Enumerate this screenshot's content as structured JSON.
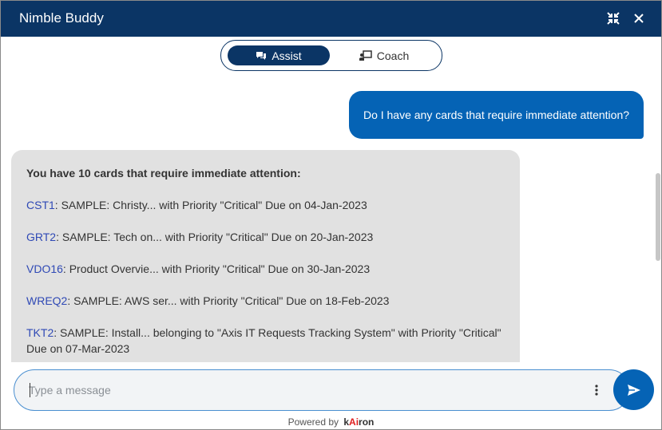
{
  "window": {
    "title": "Nimble Buddy",
    "minimize_icon": "collapse-arrows-icon",
    "close_icon": "close-icon"
  },
  "modes": {
    "assist_label": "Assist",
    "coach_label": "Coach",
    "active": "Assist"
  },
  "conversation": {
    "user_message": "Do I have any cards that require immediate attention?",
    "bot_heading": "You have 10 cards that require immediate attention:",
    "cards": [
      {
        "id": "CST1",
        "text": ": SAMPLE: Christy... with Priority \"Critical\" Due on 04-Jan-2023"
      },
      {
        "id": "GRT2",
        "text": ": SAMPLE: Tech on... with Priority \"Critical\" Due on 20-Jan-2023"
      },
      {
        "id": "VDO16",
        "text": ": Product Overvie... with Priority \"Critical\" Due on 30-Jan-2023"
      },
      {
        "id": "WREQ2",
        "text": ": SAMPLE: AWS ser... with Priority \"Critical\" Due on 18-Feb-2023"
      },
      {
        "id": "TKT2",
        "text": ": SAMPLE: Install... belonging to \"Axis IT Requests Tracking System\" with Priority \"Critical\"",
        "text_line2": "Due on 07-Mar-2023"
      }
    ]
  },
  "composer": {
    "placeholder": "Type a message",
    "value": ""
  },
  "footer": {
    "powered_by": "Powered by",
    "brand_prefix": "k",
    "brand_accent": "Ai",
    "brand_suffix": "ron"
  },
  "colors": {
    "header": "#0b3565",
    "user_bubble": "#0563b5",
    "bot_bubble": "#e1e1e1",
    "link": "#2f49b5"
  }
}
